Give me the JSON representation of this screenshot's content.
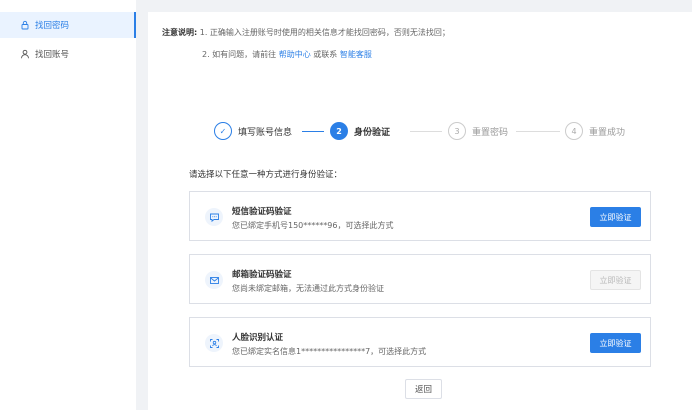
{
  "sidebar": {
    "items": [
      {
        "label": "找回密码",
        "icon": "lock-icon",
        "active": true
      },
      {
        "label": "找回账号",
        "icon": "user-icon",
        "active": false
      }
    ]
  },
  "notice": {
    "label": "注意说明:",
    "line1": "1. 正确输入注册账号时使用的相关信息才能找回密码，否则无法找回；",
    "line2_prefix": "2. 如有问题，请前往",
    "help_link": "帮助中心",
    "line2_mid": "或联系",
    "service_link": "智能客服"
  },
  "steps": [
    {
      "num": "✓",
      "label": "填写账号信息",
      "state": "done"
    },
    {
      "num": "2",
      "label": "身份验证",
      "state": "current"
    },
    {
      "num": "3",
      "label": "重置密码",
      "state": "todo"
    },
    {
      "num": "4",
      "label": "重置成功",
      "state": "todo"
    }
  ],
  "prompt": "请选择以下任意一种方式进行身份验证：",
  "methods": [
    {
      "title": "短信验证码验证",
      "desc": "您已绑定手机号150******96，可选择此方式",
      "button": "立即验证",
      "enabled": true,
      "icon": "sms-icon"
    },
    {
      "title": "邮箱验证码验证",
      "desc": "您尚未绑定邮箱，无法通过此方式身份验证",
      "button": "立即验证",
      "enabled": false,
      "icon": "mail-icon"
    },
    {
      "title": "人脸识别认证",
      "desc": "您已绑定实名信息1****************7，可选择此方式",
      "button": "立即验证",
      "enabled": true,
      "icon": "face-scan-icon"
    }
  ],
  "back_button": "返回",
  "colors": {
    "accent": "#2b7fe6",
    "background": "#f0f2f5"
  }
}
